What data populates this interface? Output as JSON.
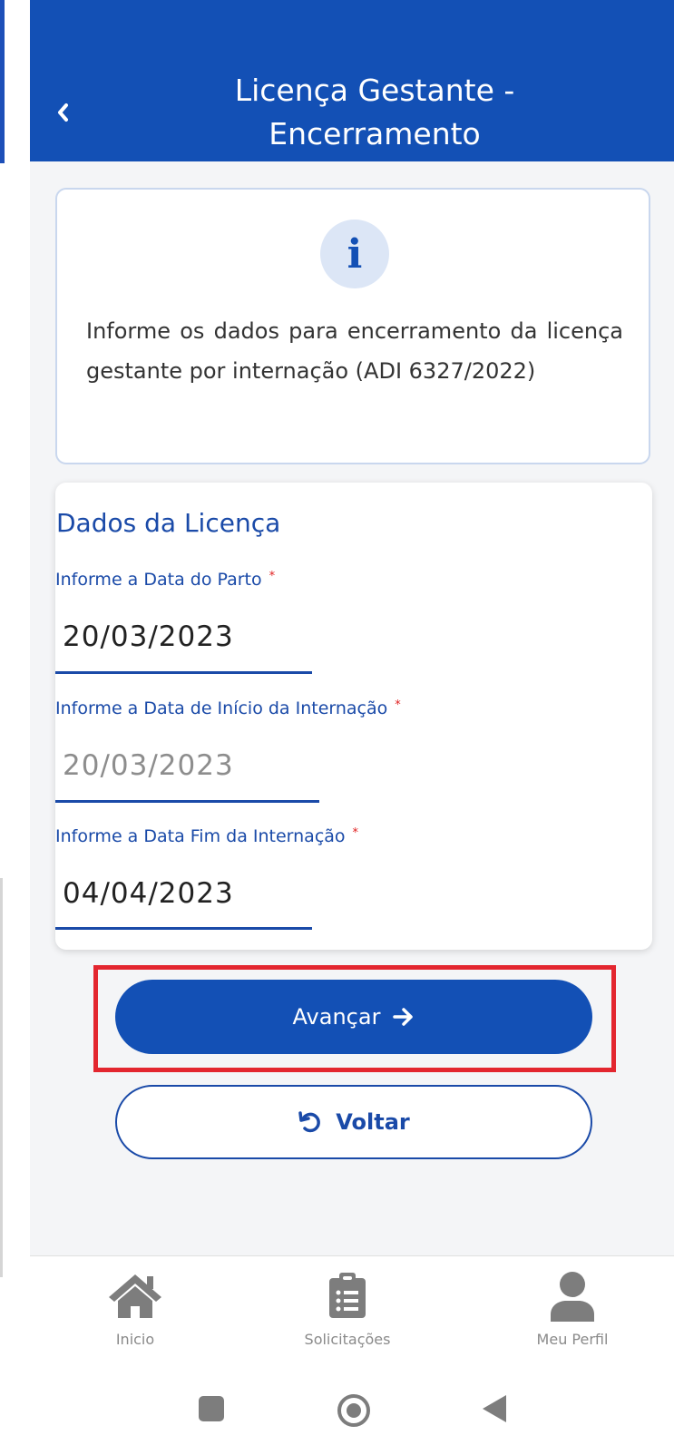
{
  "header": {
    "title_line1": "Licença Gestante -",
    "title_line2": "Encerramento"
  },
  "info": {
    "icon": "info-icon",
    "text": "Informe os dados para encerramento da licença gestante por internação (ADI 6327/2022)"
  },
  "form": {
    "section_title": "Dados da Licença",
    "fields": [
      {
        "label": "Informe a Data do Parto",
        "required_mark": "*",
        "value": "20/03/2023",
        "disabled": false
      },
      {
        "label": "Informe a Data de Início da Internação",
        "required_mark": "*",
        "value": "20/03/2023",
        "disabled": true
      },
      {
        "label": "Informe a Data Fim da Internação",
        "required_mark": "*",
        "value": "04/04/2023",
        "disabled": false
      }
    ]
  },
  "actions": {
    "next_label": "Avançar",
    "next_icon": "arrow-right-icon",
    "back_label": "Voltar",
    "back_icon": "undo-icon"
  },
  "bottom_nav": [
    {
      "label": "Inicio",
      "icon": "home-icon"
    },
    {
      "label": "Solicitações",
      "icon": "clipboard-list-icon"
    },
    {
      "label": "Meu Perfil",
      "icon": "user-icon"
    }
  ],
  "colors": {
    "primary": "#1350b5",
    "highlight": "#e3262f",
    "background": "#f4f5f7"
  }
}
